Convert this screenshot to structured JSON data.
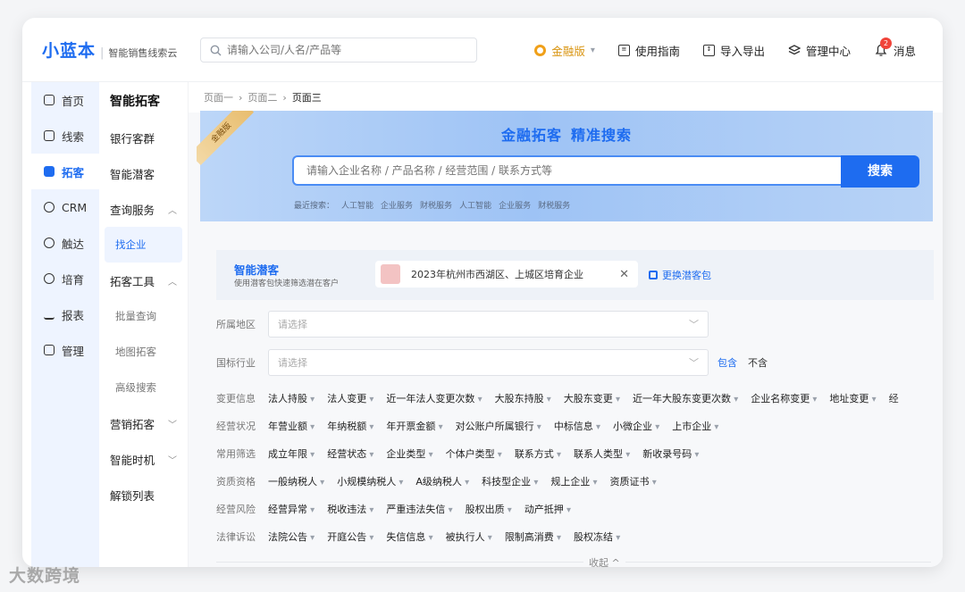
{
  "brand": {
    "name": "小蓝本",
    "subtitle": "智能销售线索云"
  },
  "top_search": {
    "placeholder": "请输入公司/人名/产品等"
  },
  "top_nav": {
    "edition": "金融版",
    "guide": "使用指南",
    "import_export": "导入导出",
    "admin": "管理中心",
    "messages": "消息",
    "message_count": "2"
  },
  "sidebar": [
    {
      "label": "首页",
      "icon": "home-icon"
    },
    {
      "label": "线索",
      "icon": "leads-icon"
    },
    {
      "label": "拓客",
      "icon": "prospect-icon",
      "active": true
    },
    {
      "label": "CRM",
      "icon": "crm-icon"
    },
    {
      "label": "触达",
      "icon": "reach-icon"
    },
    {
      "label": "培育",
      "icon": "nurture-icon"
    },
    {
      "label": "报表",
      "icon": "report-icon"
    },
    {
      "label": "管理",
      "icon": "manage-icon"
    }
  ],
  "subnav": {
    "title": "智能拓客",
    "items": [
      {
        "label": "银行客群"
      },
      {
        "label": "智能潜客"
      },
      {
        "label": "查询服务",
        "chevron": "up"
      },
      {
        "label": "找企业",
        "sub": true,
        "active": true
      },
      {
        "label": "拓客工具",
        "chevron": "up"
      },
      {
        "label": "批量查询",
        "sub": true
      },
      {
        "label": "地图拓客",
        "sub": true
      },
      {
        "label": "高级搜索",
        "sub": true
      },
      {
        "label": "营销拓客",
        "chevron": "down"
      },
      {
        "label": "智能时机",
        "chevron": "down"
      },
      {
        "label": "解锁列表"
      }
    ]
  },
  "breadcrumb": [
    "页面一",
    "页面二",
    "页面三"
  ],
  "hero": {
    "title_a": "金融拓客",
    "title_b": "精准搜索",
    "corner": "金融版",
    "placeholder": "请输入企业名称 / 产品名称 / 经营范围 / 联系方式等",
    "button": "搜索",
    "recent_label": "最近搜索：",
    "recent": [
      "人工智能",
      "企业服务",
      "财税服务",
      "人工智能",
      "企业服务",
      "财税服务"
    ]
  },
  "potential": {
    "title": "智能潜客",
    "subtitle": "使用潜客包快速筛选潜在客户",
    "package": "2023年杭州市西湖区、上城区培育企业",
    "switch": "更换潜客包"
  },
  "filters": {
    "region_label": "所属地区",
    "region_placeholder": "请选择",
    "industry_label": "国标行业",
    "industry_placeholder": "请选择",
    "include": "包含",
    "exclude": "不含",
    "rows": [
      {
        "label": "变更信息",
        "chips": [
          "法人持股",
          "法人变更",
          "近一年法人变更次数",
          "大股东持股",
          "大股东变更",
          "近一年大股东变更次数",
          "企业名称变更",
          "地址变更",
          "经"
        ]
      },
      {
        "label": "经营状况",
        "chips": [
          "年营业额",
          "年纳税额",
          "年开票金额",
          "对公账户所属银行",
          "中标信息",
          "小微企业",
          "上市企业"
        ]
      },
      {
        "label": "常用筛选",
        "chips": [
          "成立年限",
          "经营状态",
          "企业类型",
          "个体户类型",
          "联系方式",
          "联系人类型",
          "新收录号码"
        ]
      },
      {
        "label": "资质资格",
        "chips": [
          "一般纳税人",
          "小规模纳税人",
          "A级纳税人",
          "科技型企业",
          "规上企业",
          "资质证书"
        ]
      },
      {
        "label": "经营风险",
        "chips": [
          "经营异常",
          "税收违法",
          "严重违法失信",
          "股权出质",
          "动产抵押"
        ]
      },
      {
        "label": "法律诉讼",
        "chips": [
          "法院公告",
          "开庭公告",
          "失信信息",
          "被执行人",
          "限制高消费",
          "股权冻结"
        ]
      }
    ],
    "collapse": "收起 ^"
  },
  "watermark": "大数跨境"
}
